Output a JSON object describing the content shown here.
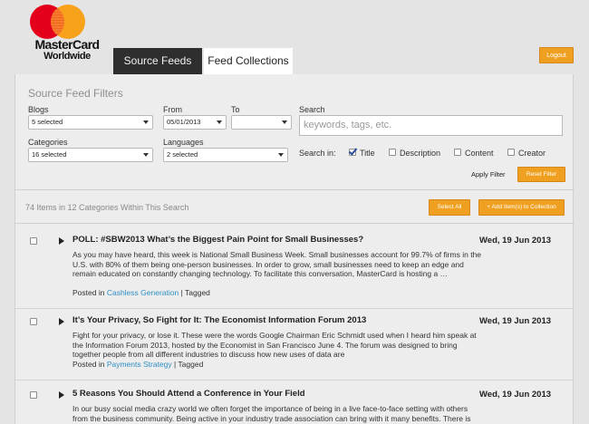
{
  "brand": {
    "name_line1": "MasterCard",
    "name_line2": "Worldwide",
    "colors": {
      "red": "#e4001b",
      "orange": "#f8a11b"
    }
  },
  "tabs": [
    {
      "label": "Source Feeds",
      "active": true
    },
    {
      "label": "Feed Collections",
      "active": false
    }
  ],
  "header": {
    "logout_label": "Logout"
  },
  "filters": {
    "title": "Source Feed Filters",
    "blogs": {
      "label": "Blogs",
      "value": "5 selected"
    },
    "from": {
      "label": "From",
      "value": "05/01/2013"
    },
    "to": {
      "label": "To",
      "value": ""
    },
    "search": {
      "label": "Search",
      "placeholder": "keywords, tags, etc."
    },
    "categories": {
      "label": "Categories",
      "value": "16 selected"
    },
    "languages": {
      "label": "Languages",
      "value": "2 selected"
    },
    "search_in": {
      "label": "Search in:",
      "options": [
        {
          "label": "Title",
          "checked": true
        },
        {
          "label": "Description",
          "checked": false
        },
        {
          "label": "Content",
          "checked": false
        },
        {
          "label": "Creator",
          "checked": false
        }
      ]
    },
    "apply_label": "Apply Filter",
    "reset_label": "Reset Filter"
  },
  "results": {
    "summary": "74 Items in 12 Categories Within This Search",
    "select_all_label": "Select All",
    "add_label": "+ Add Item(s) to Collection"
  },
  "items": [
    {
      "title": "POLL: #SBW2013 What’s the Biggest Pain Point for Small Businesses?",
      "date": "Wed, 19 Jun 2013",
      "body": "As you may have heard, this week is National Small Business Week. Small businesses account for 99.7% of firms in the U.S. with 80% of them being one-person businesses. In order to grow, small businesses need to keep an edge and remain educated on constantly changing technology. To facilitate this conversation, MasterCard is hosting a …",
      "posted_in": "Posted in",
      "category": "Cashless Generation",
      "tagged": "| Tagged"
    },
    {
      "title": "It’s Your Privacy, So Fight for It: The Economist Information Forum 2013",
      "date": "Wed, 19 Jun 2013",
      "body": "Fight for your privacy, or lose it. These were the words Google Chairman Eric Schmidt used when I heard him speak at the Information Forum 2013, hosted by the Economist in San Francisco June 4. The forum was designed to bring together people from all different industries to discuss how new uses of data are",
      "posted_in": "Posted in",
      "category": "Payments Strategy",
      "tagged": "| Tagged"
    },
    {
      "title": "5 Reasons You Should Attend a Conference in Your Field",
      "date": "Wed, 19 Jun 2013",
      "body": "In our busy social media crazy world we often forget the importance of being in a live face-to-face setting with others from the business community. Being active in your industry trade association can bring with it many benefits. There is power in",
      "posted_in": "",
      "category": "",
      "tagged": ""
    }
  ]
}
